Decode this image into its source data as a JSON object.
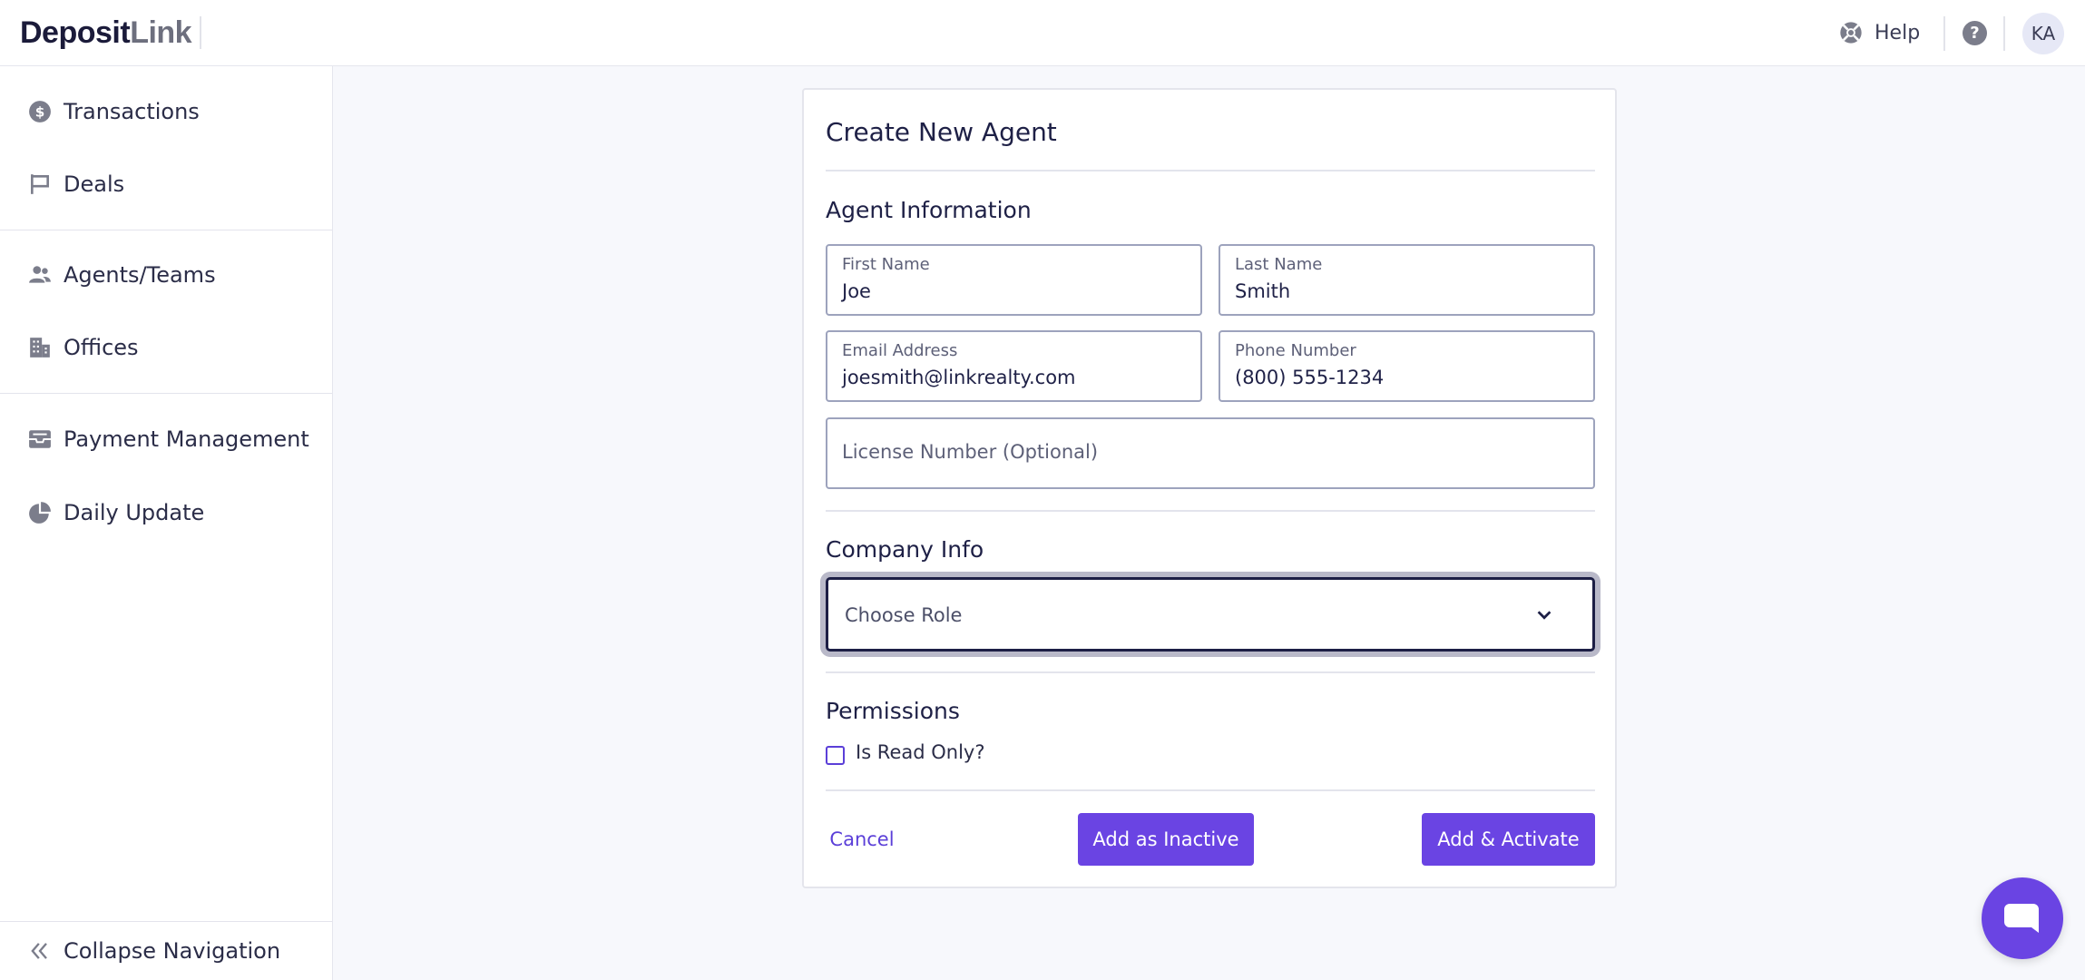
{
  "brand": {
    "logo_part1": "Deposit",
    "logo_part2": "Link"
  },
  "header": {
    "help_label": "Help",
    "help_question_glyph": "?",
    "avatar_initials": "KA"
  },
  "sidebar": {
    "items": [
      {
        "label": "Transactions",
        "icon": "dollar-circle-icon"
      },
      {
        "label": "Deals",
        "icon": "flag-icon"
      },
      {
        "label": "Agents/Teams",
        "icon": "people-icon"
      },
      {
        "label": "Offices",
        "icon": "building-icon"
      },
      {
        "label": "Payment Management",
        "icon": "inbox-tray-icon"
      },
      {
        "label": "Daily Update",
        "icon": "pie-chart-icon"
      }
    ],
    "collapse_label": "Collapse Navigation"
  },
  "form": {
    "title": "Create New Agent",
    "agent_section": "Agent Information",
    "first_name": {
      "label": "First Name",
      "value": "Joe"
    },
    "last_name": {
      "label": "Last Name",
      "value": "Smith"
    },
    "email": {
      "label": "Email Address",
      "value": "joesmith@linkrealty.com"
    },
    "phone": {
      "label": "Phone Number",
      "value": "(800) 555-1234"
    },
    "license": {
      "placeholder": "License Number (Optional)"
    },
    "company_section": "Company Info",
    "role_select": {
      "placeholder": "Choose Role"
    },
    "permissions_section": "Permissions",
    "read_only": {
      "label": "Is Read Only?",
      "checked": false
    },
    "cancel_label": "Cancel",
    "add_inactive_label": "Add as Inactive",
    "add_activate_label": "Add & Activate"
  },
  "colors": {
    "accent": "#6a44e3",
    "focus_border": "#1c1e45",
    "background": "#f7f8fc"
  }
}
